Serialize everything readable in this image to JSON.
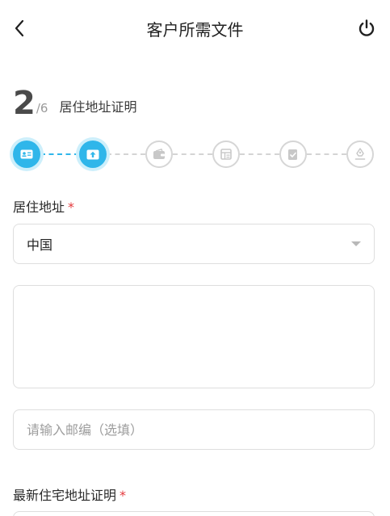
{
  "header": {
    "title": "客户所需文件",
    "back_icon": "chevron-left-icon",
    "power_icon": "power-icon"
  },
  "progress": {
    "current": "2",
    "total": "/6",
    "step_title": "居住地址证明"
  },
  "stepper": {
    "active_color": "#2fb6ea",
    "steps": [
      {
        "icon": "id-card-icon",
        "state": "done"
      },
      {
        "icon": "upload-icon",
        "state": "current"
      },
      {
        "icon": "wallet-icon",
        "state": "pending"
      },
      {
        "icon": "form-icon",
        "state": "pending"
      },
      {
        "icon": "document-edit-icon",
        "state": "pending"
      },
      {
        "icon": "signature-pen-icon",
        "state": "pending"
      }
    ]
  },
  "form": {
    "address_label": "居住地址",
    "required_mark": "*",
    "country_value": "中国",
    "address_detail_value": "",
    "postal_placeholder": "请输入邮编（选填）",
    "proof_label": "最新住宅地址证明"
  }
}
